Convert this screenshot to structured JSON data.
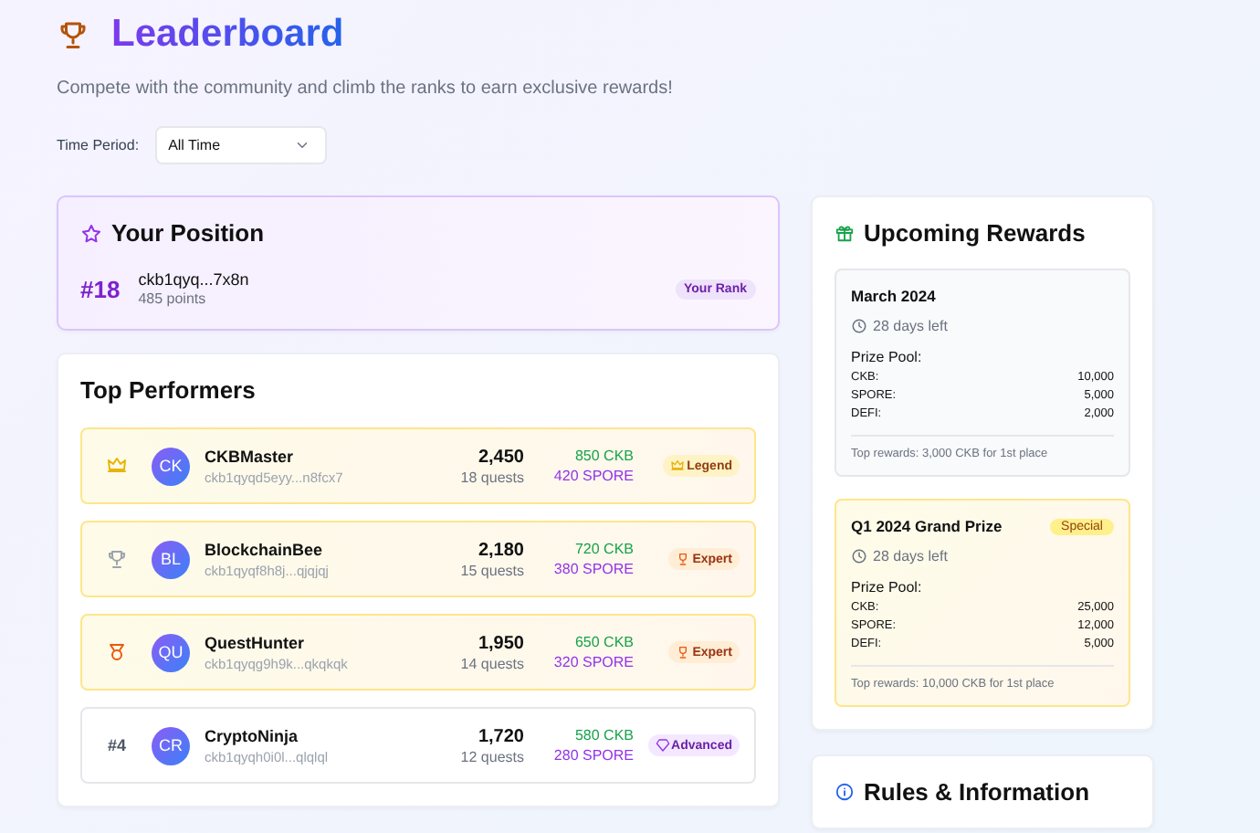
{
  "header": {
    "title": "Leaderboard",
    "subtitle": "Compete with the community and climb the ranks to earn exclusive rewards!"
  },
  "filter": {
    "label": "Time Period:",
    "value": "All Time"
  },
  "your_position": {
    "title": "Your Position",
    "rank": "#18",
    "address": "ckb1qyq...7x8n",
    "points": "485 points",
    "badge": "Your Rank"
  },
  "top_performers": {
    "title": "Top Performers",
    "rows": [
      {
        "kind": "crown",
        "highlighted": true,
        "initials": "CK",
        "name": "CKBMaster",
        "address": "ckb1qyqd5eyy...n8fcx7",
        "points": "2,450",
        "quests": "18 quests",
        "ckb": "850 CKB",
        "spore": "420 SPORE",
        "badge": {
          "kind": "legend",
          "label": "Legend"
        }
      },
      {
        "kind": "trophy",
        "highlighted": true,
        "initials": "BL",
        "name": "BlockchainBee",
        "address": "ckb1qyqf8h8j...qjqjqj",
        "points": "2,180",
        "quests": "15 quests",
        "ckb": "720 CKB",
        "spore": "380 SPORE",
        "badge": {
          "kind": "expert",
          "label": "Expert"
        }
      },
      {
        "kind": "medal",
        "highlighted": true,
        "initials": "QU",
        "name": "QuestHunter",
        "address": "ckb1qyqg9h9k...qkqkqk",
        "points": "1,950",
        "quests": "14 quests",
        "ckb": "650 CKB",
        "spore": "320 SPORE",
        "badge": {
          "kind": "expert",
          "label": "Expert"
        }
      },
      {
        "kind": "number",
        "rank": "#4",
        "highlighted": false,
        "initials": "CR",
        "name": "CryptoNinja",
        "address": "ckb1qyqh0i0l...qlqlql",
        "points": "1,720",
        "quests": "12 quests",
        "ckb": "580 CKB",
        "spore": "280 SPORE",
        "badge": {
          "kind": "advanced",
          "label": "Advanced"
        }
      }
    ]
  },
  "rewards": {
    "title": "Upcoming Rewards",
    "items": [
      {
        "title": "March 2024",
        "special": false,
        "time_left": "28 days left",
        "pool_label": "Prize Pool:",
        "pool": [
          {
            "token": "CKB:",
            "amount": "10,000"
          },
          {
            "token": "SPORE:",
            "amount": "5,000"
          },
          {
            "token": "DEFI:",
            "amount": "2,000"
          }
        ],
        "note": "Top rewards: 3,000 CKB for 1st place"
      },
      {
        "title": "Q1 2024 Grand Prize",
        "special": true,
        "tag": "Special",
        "time_left": "28 days left",
        "pool_label": "Prize Pool:",
        "pool": [
          {
            "token": "CKB:",
            "amount": "25,000"
          },
          {
            "token": "SPORE:",
            "amount": "12,000"
          },
          {
            "token": "DEFI:",
            "amount": "5,000"
          }
        ],
        "note": "Top rewards: 10,000 CKB for 1st place"
      }
    ]
  },
  "rules": {
    "title": "Rules & Information"
  }
}
